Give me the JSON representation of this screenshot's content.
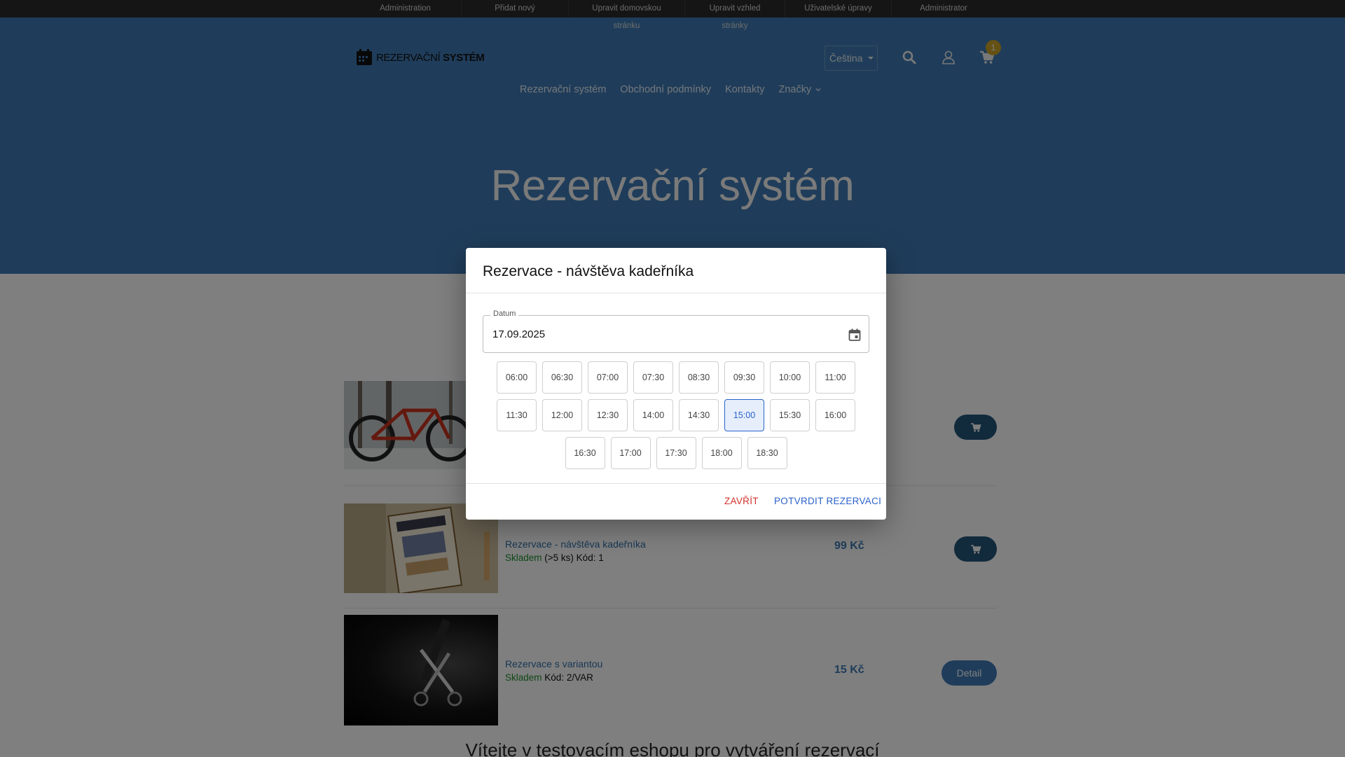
{
  "adminbar": {
    "items": [
      "Administration",
      "Přidat nový",
      "Upravit domovskou stránku",
      "Upravit vzhled stránky",
      "Uživatelské úpravy",
      "Administrator"
    ]
  },
  "header": {
    "logo_text_regular": "REZERVAČNÍ",
    "logo_text_bold": "SYSTÉM",
    "language": "Čeština",
    "cart_count": "1"
  },
  "nav": {
    "items": [
      "Rezervační systém",
      "Obchodní podmínky",
      "Kontakty",
      "Značky"
    ]
  },
  "hero": {
    "title": "Rezervační systém"
  },
  "products": [
    {
      "name": "",
      "stock": "",
      "detail": "",
      "price": ""
    },
    {
      "name": "Rezervace - návštěva kadeřníka",
      "stock": "Skladem",
      "detail": "(>5 ks)  Kód: 1",
      "price": "99 Kč"
    },
    {
      "name": "Rezervace s variantou",
      "stock": "Skladem",
      "detail": "Kód: 2/VAR",
      "price": "15 Kč",
      "button": "Detail"
    }
  ],
  "welcome": "Vítejte v testovacím eshopu pro vytváření rezervací",
  "modal": {
    "title": "Rezervace - návštěva kadeřníka",
    "date_label": "Datum",
    "date_value": "17.09.2025",
    "selected_slot": "15:00",
    "slots": [
      "06:00",
      "06:30",
      "07:00",
      "07:30",
      "08:30",
      "09:30",
      "10:00",
      "11:00",
      "11:30",
      "12:00",
      "12:30",
      "14:00",
      "14:30",
      "15:00",
      "15:30",
      "16:00",
      "16:30",
      "17:00",
      "17:30",
      "18:00",
      "18:30"
    ],
    "close_label": "ZAVŘÍT",
    "confirm_label": "POTVRDIT REZERVACI"
  },
  "colors": {
    "hero": "#3f7ab5",
    "adminbar": "#2b2b2b",
    "accent": "#2a62c9",
    "danger": "#d0322c",
    "stock_ok": "#1f8f2f",
    "badge": "#c9a227"
  }
}
